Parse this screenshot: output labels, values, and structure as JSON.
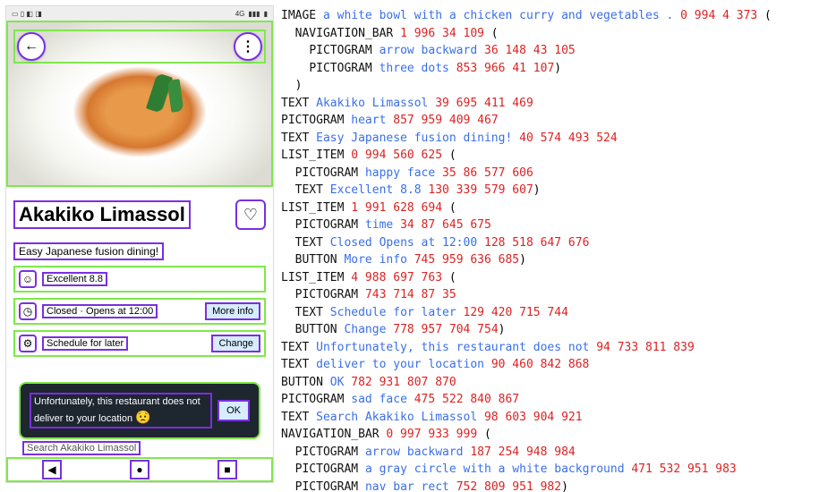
{
  "phone": {
    "status_bar": {
      "network": "4G",
      "signal": "▮▮▮",
      "battery": "▮"
    },
    "hero": {
      "image_desc": "a white bowl with a chicken curry and vegetables .",
      "nav": {
        "back_glyph": "←",
        "menu_glyph": "⋮"
      }
    },
    "title": "Akakiko Limassol",
    "heart_glyph": "♡",
    "subtitle": "Easy Japanese fusion dining!",
    "list": [
      {
        "icon": "☺",
        "text": "Excellent 8.8"
      },
      {
        "icon": "◷",
        "text": "Closed · Opens at 12:00",
        "button": "More info"
      },
      {
        "icon": "⚙",
        "text": "Schedule for later",
        "button": "Change"
      }
    ],
    "toast": {
      "line1": "Unfortunately, this restaurant does not",
      "line2": "deliver to your location",
      "sad": "😟",
      "ok": "OK"
    },
    "search_hint": "Search Akakiko Limassol",
    "bottom_nav": {
      "back": "◀",
      "home": "●",
      "recent": "■"
    }
  },
  "annotations": [
    {
      "i": 0,
      "type": "IMAGE",
      "desc": "a white bowl with a chicken curry and vegetables .",
      "coords": "0 994 4 373",
      "open": true
    },
    {
      "i": 1,
      "type": "NAVIGATION_BAR",
      "desc": "",
      "coords": "1 996 34 109",
      "open": true
    },
    {
      "i": 2,
      "type": "PICTOGRAM",
      "desc": "arrow backward",
      "coords": "36 148 43 105"
    },
    {
      "i": 2,
      "type": "PICTOGRAM",
      "desc": "three dots",
      "coords": "853 966 41 107",
      "close": ")"
    },
    {
      "i": 1,
      "close_only": ")"
    },
    {
      "i": 0,
      "type": "TEXT",
      "desc": "Akakiko Limassol",
      "coords": "39 695 411 469"
    },
    {
      "i": 0,
      "type": "PICTOGRAM",
      "desc": "heart",
      "coords": "857 959 409 467"
    },
    {
      "i": 0,
      "type": "TEXT",
      "desc": "Easy Japanese fusion dining!",
      "coords": "40 574 493 524"
    },
    {
      "i": 0,
      "type": "LIST_ITEM",
      "desc": "",
      "coords": "0 994 560 625",
      "open": true
    },
    {
      "i": 1,
      "type": "PICTOGRAM",
      "desc": "happy face",
      "coords": "35 86 577 606"
    },
    {
      "i": 1,
      "type": "TEXT",
      "desc": "Excellent 8.8",
      "coords": "130 339 579 607",
      "close": ")"
    },
    {
      "i": 0,
      "type": "LIST_ITEM",
      "desc": "",
      "coords": "1 991 628 694",
      "open": true
    },
    {
      "i": 1,
      "type": "PICTOGRAM",
      "desc": "time",
      "coords": "34 87 645 675"
    },
    {
      "i": 1,
      "type": "TEXT",
      "desc": "Closed Opens at 12:00",
      "coords": "128 518 647 676"
    },
    {
      "i": 1,
      "type": "BUTTON",
      "desc": "More info",
      "coords": "745 959 636 685",
      "close": ")"
    },
    {
      "i": 0,
      "type": "LIST_ITEM",
      "desc": "",
      "coords": "4 988 697 763",
      "open": true
    },
    {
      "i": 1,
      "type": "PICTOGRAM",
      "desc": "",
      "coords": "743 714 87 35"
    },
    {
      "i": 1,
      "type": "TEXT",
      "desc": "Schedule for later",
      "coords": "129 420 715 744"
    },
    {
      "i": 1,
      "type": "BUTTON",
      "desc": "Change",
      "coords": "778 957 704 754",
      "close": ")"
    },
    {
      "i": 0,
      "type": "TEXT",
      "desc": "Unfortunately, this restaurant does not",
      "coords": "94 733 811 839"
    },
    {
      "i": 0,
      "type": "TEXT",
      "desc": "deliver to your location",
      "coords": "90 460 842 868"
    },
    {
      "i": 0,
      "type": "BUTTON",
      "desc": "OK",
      "coords": "782 931 807 870"
    },
    {
      "i": 0,
      "type": "PICTOGRAM",
      "desc": "sad face",
      "coords": "475 522 840 867"
    },
    {
      "i": 0,
      "type": "TEXT",
      "desc": "Search Akakiko Limassol",
      "coords": "98 603 904 921"
    },
    {
      "i": 0,
      "type": "NAVIGATION_BAR",
      "desc": "",
      "coords": "0 997 933 999",
      "open": true
    },
    {
      "i": 1,
      "type": "PICTOGRAM",
      "desc": "arrow backward",
      "coords": "187 254 948 984"
    },
    {
      "i": 1,
      "type": "PICTOGRAM",
      "desc": "a gray circle with a white background",
      "coords": "471 532 951 983"
    },
    {
      "i": 1,
      "type": "PICTOGRAM",
      "desc": "nav bar rect",
      "coords": "752 809 951 982",
      "close": ")"
    }
  ]
}
